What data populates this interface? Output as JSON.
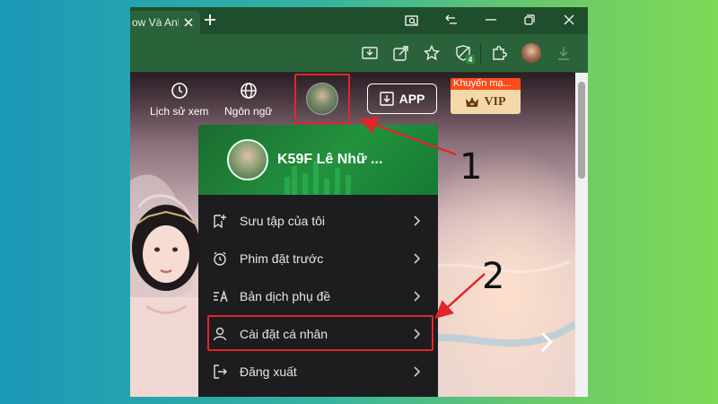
{
  "browser": {
    "tab_title": "ow Và Anh",
    "icons": {
      "close_tab": "close-icon",
      "new_tab": "plus-icon",
      "search_tabs": "tab-search-icon",
      "back": "back-icon",
      "minimize": "minimize-icon",
      "restore": "restore-icon",
      "close_window": "close-icon"
    },
    "toolbar": {
      "extension_badge": "4",
      "icons": [
        "download-app-icon",
        "share-icon",
        "star-icon",
        "shield-extension-icon",
        "puzzle-icon",
        "profile-icon",
        "download-icon"
      ]
    }
  },
  "site_nav": {
    "history_label": "Lịch sử xem",
    "language_label": "Ngôn ngữ",
    "app_label": "APP",
    "promo_label": "Khuyến mạ...",
    "vip_label": "VIP"
  },
  "dropdown": {
    "username": "K59F Lê Nhữ ...",
    "items": [
      {
        "label": "Sưu tập của tôi",
        "icon": "collection-icon"
      },
      {
        "label": "Phim đặt trước",
        "icon": "alarm-icon"
      },
      {
        "label": "Bản dịch phụ đề",
        "icon": "subtitle-translate-icon"
      },
      {
        "label": "Cài đặt cá nhân",
        "icon": "user-icon"
      },
      {
        "label": "Đăng xuất",
        "icon": "logout-icon"
      }
    ]
  },
  "annotations": {
    "step1": "1",
    "step2": "2",
    "color": "#e0262b"
  },
  "colors": {
    "browser_green": "#2a6339",
    "menu_bg": "#1d1d1f",
    "vip_gold": "#f4d9a8",
    "promo_orange": "#ff4a1a"
  }
}
